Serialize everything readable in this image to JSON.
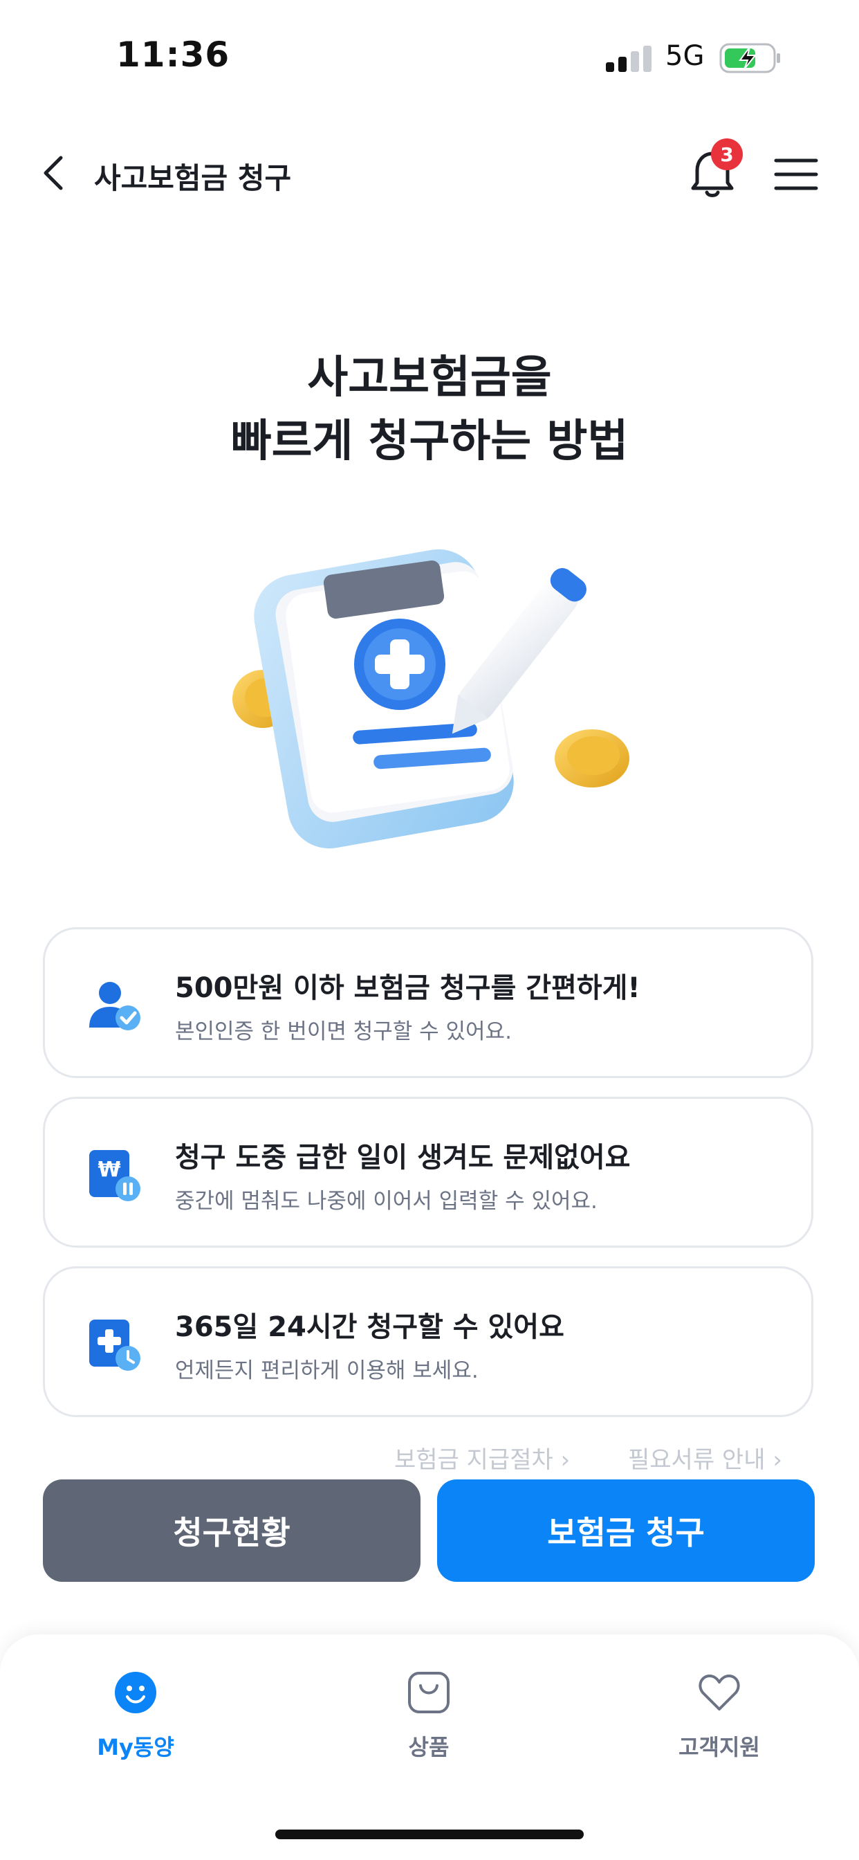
{
  "status_bar": {
    "time": "11:36",
    "network": "5G"
  },
  "header": {
    "title": "사고보험금 청구",
    "notification_count": "3"
  },
  "hero": {
    "title_line1": "사고보험금을",
    "title_line2": "빠르게 청구하는 방법"
  },
  "features": [
    {
      "title": "500만원 이하 보험금 청구를 간편하게!",
      "subtitle": "본인인증 한 번이면 청구할 수 있어요.",
      "icon": "user-verified-icon"
    },
    {
      "title": "청구 도중 급한 일이 생겨도 문제없어요",
      "subtitle": "중간에 멈춰도 나중에 이어서 입력할 수 있어요.",
      "icon": "won-pause-icon"
    },
    {
      "title": "365일 24시간 청구할 수 있어요",
      "subtitle": "언제든지 편리하게 이용해 보세요.",
      "icon": "medical-clock-icon"
    }
  ],
  "links": {
    "payment_process": "보험금 지급절차",
    "required_docs": "필요서류 안내"
  },
  "buttons": {
    "claim_status": "청구현황",
    "claim": "보험금 청구"
  },
  "tabbar": {
    "items": [
      {
        "label": "My동양",
        "icon": "smile-icon",
        "active": true
      },
      {
        "label": "상품",
        "icon": "bag-icon",
        "active": false
      },
      {
        "label": "고객지원",
        "icon": "heart-icon",
        "active": false
      }
    ]
  },
  "colors": {
    "primary": "#0a84f6",
    "secondary_button": "#5f6676",
    "badge": "#e8323c"
  }
}
